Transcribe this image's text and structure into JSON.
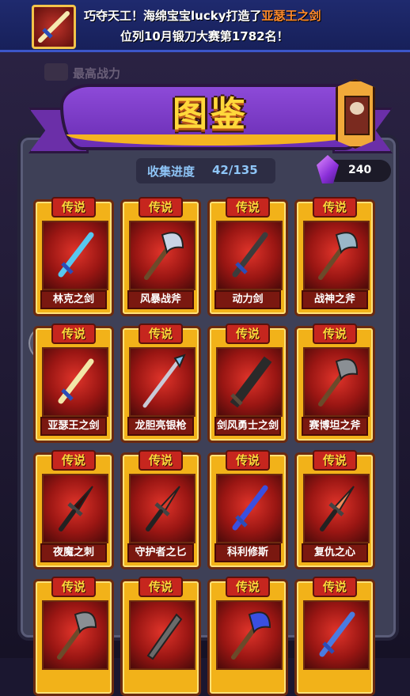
{
  "banner": {
    "line1_prefix": "巧夺天工！海绵宝宝lucky打造了",
    "line1_highlight": "亚瑟王之剑",
    "line2": "位列10月锻刀大赛第1782名！"
  },
  "background": {
    "label": "最高战力"
  },
  "header": {
    "title": "图鉴"
  },
  "progress": {
    "label": "收集进度",
    "value": "42/135"
  },
  "currency": {
    "value": "240",
    "icon": "purple-gem-icon"
  },
  "cards": [
    {
      "tag": "传说",
      "name": "林克之剑",
      "icon": "sword-icon",
      "color": "#58c7f0"
    },
    {
      "tag": "传说",
      "name": "风暴战斧",
      "icon": "axe-icon",
      "color": "#c9d4e6"
    },
    {
      "tag": "传说",
      "name": "动力剑",
      "icon": "sword-icon",
      "color": "#3c3c3c"
    },
    {
      "tag": "传说",
      "name": "战神之斧",
      "icon": "axe-icon",
      "color": "#9ab7c8"
    },
    {
      "tag": "传说",
      "name": "亚瑟王之剑",
      "icon": "sword-icon",
      "color": "#f2e7a8"
    },
    {
      "tag": "传说",
      "name": "龙胆亮银枪",
      "icon": "spear-icon",
      "color": "#7cc3f0"
    },
    {
      "tag": "传说",
      "name": "剑风勇士之剑",
      "icon": "greatsword-icon",
      "color": "#2a2a2a"
    },
    {
      "tag": "传说",
      "name": "赛博坦之斧",
      "icon": "axe-icon",
      "color": "#8a8f94"
    },
    {
      "tag": "传说",
      "name": "夜魔之刺",
      "icon": "dagger-icon",
      "color": "#3a0a0a"
    },
    {
      "tag": "传说",
      "name": "守护者之匕",
      "icon": "dagger-icon",
      "color": "#d63a2a"
    },
    {
      "tag": "传说",
      "name": "科利修斯",
      "icon": "sword-icon",
      "color": "#3a4fe0"
    },
    {
      "tag": "传说",
      "name": "复仇之心",
      "icon": "dagger-icon",
      "color": "#f08a5a"
    },
    {
      "tag": "传说",
      "name": "",
      "icon": "axe-icon",
      "color": "#8a8f94"
    },
    {
      "tag": "传说",
      "name": "",
      "icon": "saw-sword-icon",
      "color": "#6a6a6a"
    },
    {
      "tag": "传说",
      "name": "",
      "icon": "axe-icon",
      "color": "#3a4fe0"
    },
    {
      "tag": "传说",
      "name": "",
      "icon": "sword-icon",
      "color": "#4a7be0"
    }
  ]
}
